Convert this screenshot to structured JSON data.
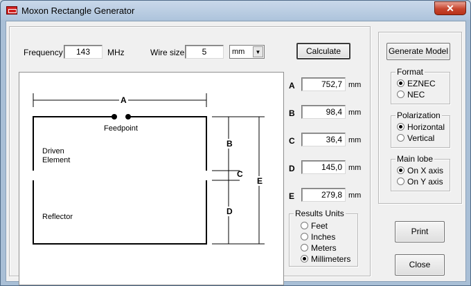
{
  "window": {
    "title": "Moxon Rectangle Generator",
    "close_glyph": "✕"
  },
  "inputs": {
    "frequency_label": "Frequency",
    "frequency_value": "143",
    "frequency_unit": "MHz",
    "wire_label": "Wire size",
    "wire_value": "5",
    "wire_unit": "mm",
    "wire_unit_dropdown": "▼"
  },
  "buttons": {
    "calculate": "Calculate",
    "generate": "Generate Model",
    "print": "Print",
    "close": "Close"
  },
  "diagram": {
    "label_a": "A",
    "label_b": "B",
    "label_c": "C",
    "label_d": "D",
    "label_e": "E",
    "feedpoint": "Feedpoint",
    "driven_line1": "Driven",
    "driven_line2": "Element",
    "reflector": "Reflector"
  },
  "results": [
    {
      "label": "A",
      "value": "752,7",
      "unit": "mm"
    },
    {
      "label": "B",
      "value": "98,4",
      "unit": "mm"
    },
    {
      "label": "C",
      "value": "36,4",
      "unit": "mm"
    },
    {
      "label": "D",
      "value": "145,0",
      "unit": "mm"
    },
    {
      "label": "E",
      "value": "279,8",
      "unit": "mm"
    }
  ],
  "results_units": {
    "title": "Results Units",
    "options": [
      {
        "label": "Feet",
        "selected": false
      },
      {
        "label": "Inches",
        "selected": false
      },
      {
        "label": "Meters",
        "selected": false
      },
      {
        "label": "Millimeters",
        "selected": true
      }
    ]
  },
  "format": {
    "title": "Format",
    "options": [
      {
        "label": "EZNEC",
        "selected": true
      },
      {
        "label": "NEC",
        "selected": false
      }
    ]
  },
  "polarization": {
    "title": "Polarization",
    "options": [
      {
        "label": "Horizontal",
        "selected": true
      },
      {
        "label": "Vertical",
        "selected": false
      }
    ]
  },
  "main_lobe": {
    "title": "Main lobe",
    "options": [
      {
        "label": "On X axis",
        "selected": true
      },
      {
        "label": "On Y axis",
        "selected": false
      }
    ]
  }
}
